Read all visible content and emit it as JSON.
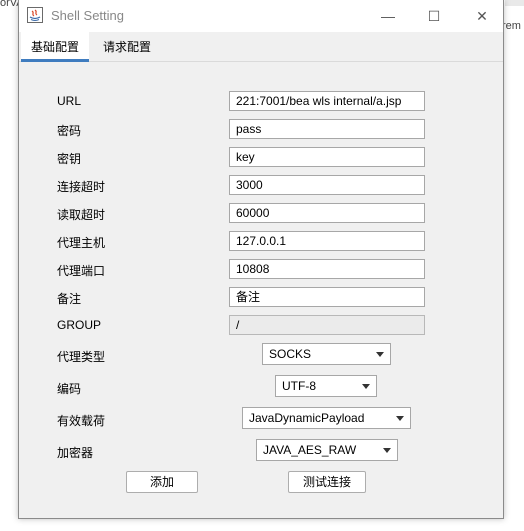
{
  "window": {
    "title": "Shell Setting",
    "minimize_symbol": "—",
    "maximize_symbol": "☐",
    "close_symbol": "✕"
  },
  "background": {
    "fragment_top_left": "orVA",
    "fragment_right": "rem"
  },
  "tabs": [
    {
      "label": "基础配置",
      "active": true
    },
    {
      "label": "请求配置",
      "active": false
    }
  ],
  "form": {
    "fields": [
      {
        "label": "URL",
        "value": "221:7001/bea wls internal/a.jsp",
        "disabled": false
      },
      {
        "label": "密码",
        "value": "pass",
        "disabled": false
      },
      {
        "label": "密钥",
        "value": "key",
        "disabled": false
      },
      {
        "label": "连接超时",
        "value": "3000",
        "disabled": false
      },
      {
        "label": "读取超时",
        "value": "60000",
        "disabled": false
      },
      {
        "label": "代理主机",
        "value": "127.0.0.1",
        "disabled": false
      },
      {
        "label": "代理端口",
        "value": "10808",
        "disabled": false
      },
      {
        "label": "备注",
        "value": "备注",
        "disabled": false
      },
      {
        "label": "GROUP",
        "value": "/",
        "disabled": true
      }
    ],
    "selects": [
      {
        "label": "代理类型",
        "value": "SOCKS"
      },
      {
        "label": "编码",
        "value": "UTF-8"
      },
      {
        "label": "有效载荷",
        "value": "JavaDynamicPayload"
      },
      {
        "label": "加密器",
        "value": "JAVA_AES_RAW"
      }
    ]
  },
  "buttons": {
    "add": "添加",
    "test_connection": "测试连接"
  },
  "colors": {
    "tab_active_underline": "#3f7cbf",
    "window_bg": "#f0f0f0"
  }
}
